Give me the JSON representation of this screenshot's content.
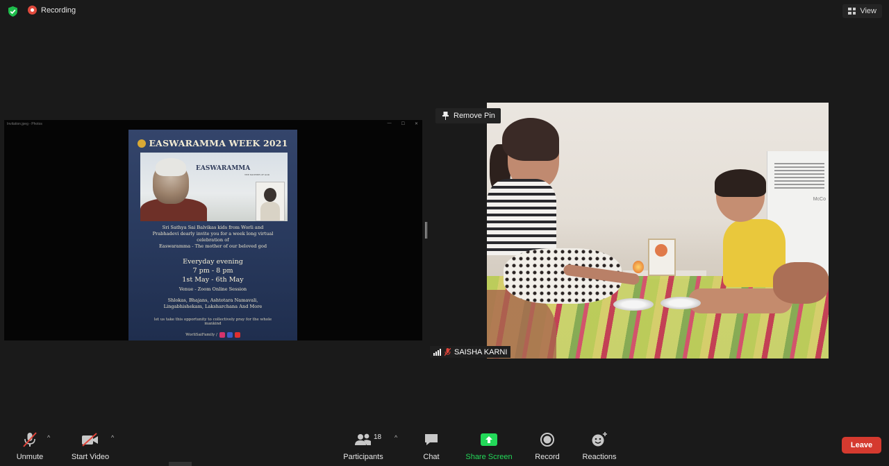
{
  "topbar": {
    "recording_label": "Recording",
    "view_label": "View"
  },
  "shared_screen": {
    "window_title": "Invitation.jpeg - Photos",
    "window_controls": [
      "—",
      "☐",
      "✕"
    ],
    "poster": {
      "title": "EASWARAMMA WEEK 2021",
      "photo_caption": "EASWARAMMA",
      "photo_subcaption": "THE MOTHER OF GOD",
      "invite_lines": [
        "Sri Sathya Sai Balvikas kids from Worli and",
        "Prabhadevi dearly invite you for a week long virtual",
        "celebration of",
        "Easwaramma - The mother of our beloved god"
      ],
      "schedule_lines": [
        "Everyday evening",
        "7 pm - 8 pm",
        "1st May - 6th May"
      ],
      "venue": "Venue - Zoom Online Session",
      "program_lines": [
        "Shlokas, Bhajans, Ashtotara Namavali,",
        "Lingabhishekam, Laksharchana And More"
      ],
      "closing_lines": [
        "let us take this opportunity to collectively pray for the whole",
        "mankind"
      ],
      "social_handle": "WorliSaiFamily /"
    }
  },
  "video_tile": {
    "remove_pin_label": "Remove Pin",
    "participant_name": "SAISHA KARNI"
  },
  "toolbar": {
    "unmute_label": "Unmute",
    "start_video_label": "Start Video",
    "participants_label": "Participants",
    "participants_count": "18",
    "chat_label": "Chat",
    "share_screen_label": "Share Screen",
    "record_label": "Record",
    "reactions_label": "Reactions",
    "leave_label": "Leave"
  },
  "colors": {
    "background": "#1a1a1a",
    "share_screen_green": "#23d959",
    "leave_red": "#d53a2f",
    "security_green": "#1ebd4c",
    "recording_red": "#e04a3d",
    "muted_red": "#e0443a"
  },
  "icons": {
    "security": "shield-check-icon",
    "recording": "record-dot-icon",
    "view": "grid-icon",
    "pin": "pin-icon",
    "signal": "signal-bars-icon",
    "participant_muted": "mic-muted-icon",
    "unmute": "mic-slash-icon",
    "start_video": "camera-slash-icon",
    "participants": "people-icon",
    "chat": "chat-bubble-icon",
    "share_screen": "share-arrow-up-icon",
    "record": "record-icon",
    "reactions": "smiley-plus-icon",
    "caret": "chevron-up-icon"
  }
}
